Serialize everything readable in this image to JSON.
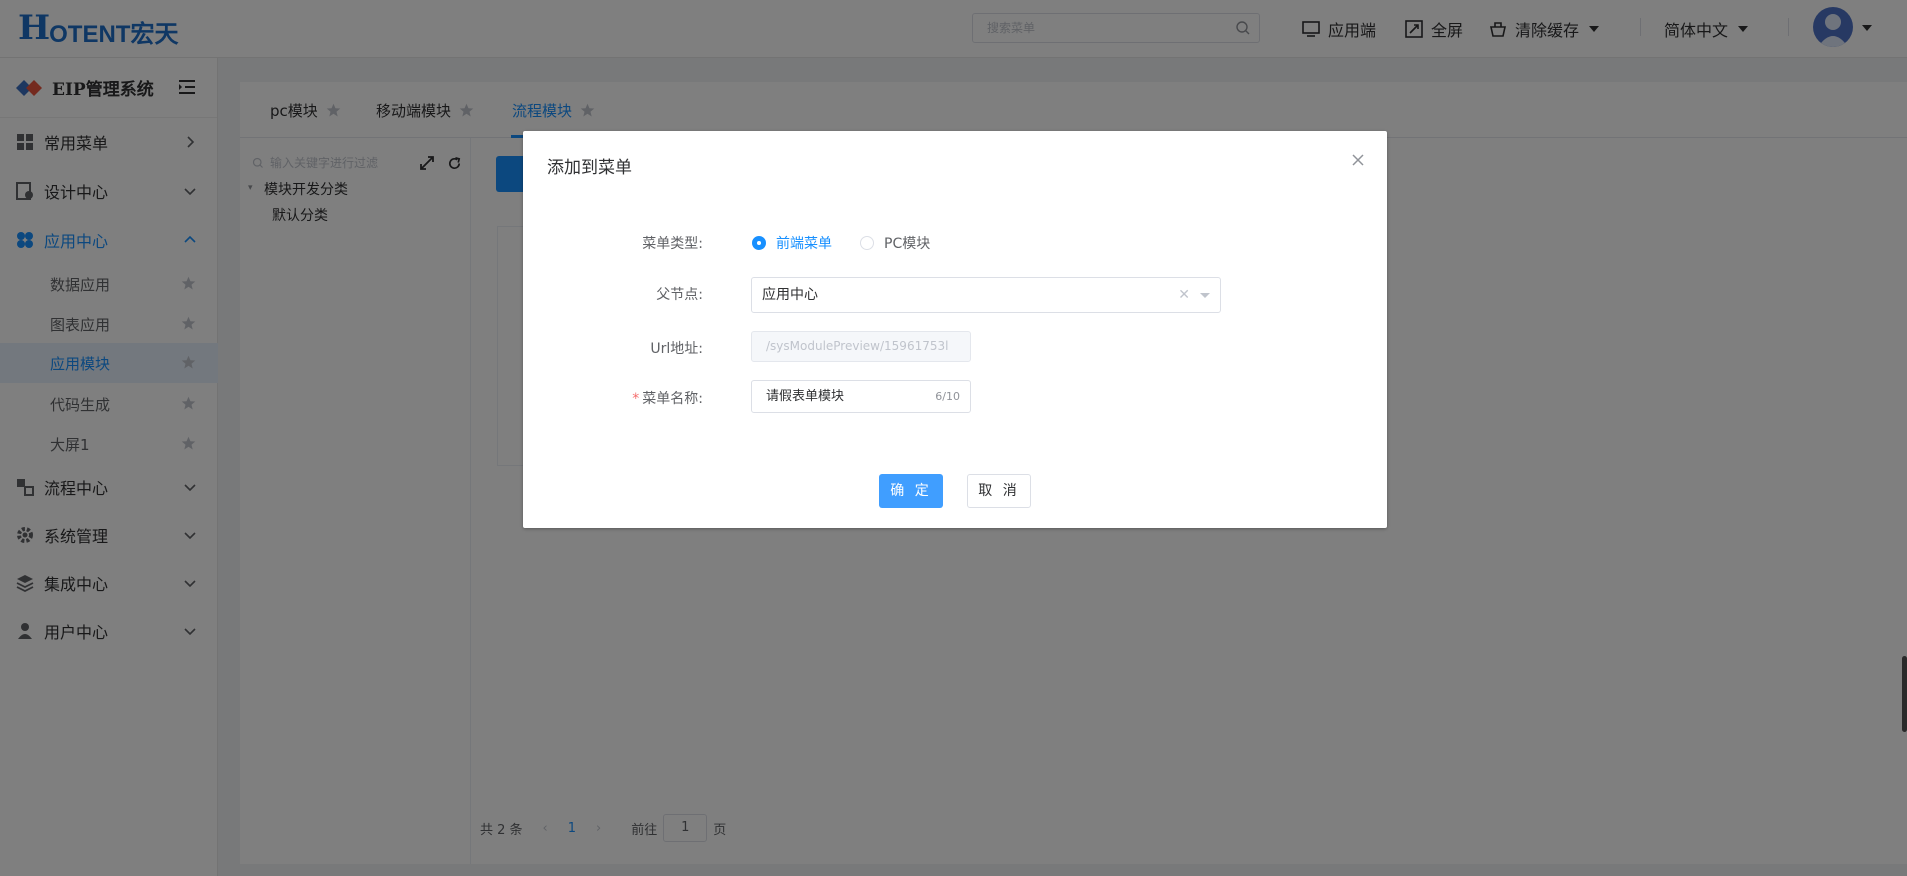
{
  "header": {
    "logo_text": "HOTENT宏天",
    "search_placeholder": "搜索菜单",
    "app_label": "应用端",
    "fullscreen_label": "全屏",
    "clear_cache_label": "清除缓存",
    "language_label": "简体中文"
  },
  "sidebar": {
    "brand": "EIP管理系统",
    "menus": [
      {
        "label": "常用菜单",
        "icon": "grid-icon"
      },
      {
        "label": "设计中心",
        "icon": "design-icon"
      },
      {
        "label": "应用中心",
        "icon": "apps-icon"
      },
      {
        "label": "流程中心",
        "icon": "flow-icon"
      },
      {
        "label": "系统管理",
        "icon": "gear-icon"
      },
      {
        "label": "集成中心",
        "icon": "layers-icon"
      },
      {
        "label": "用户中心",
        "icon": "user-icon"
      }
    ],
    "sub_items": [
      {
        "label": "数据应用"
      },
      {
        "label": "图表应用"
      },
      {
        "label": "应用模块"
      },
      {
        "label": "代码生成"
      },
      {
        "label": "大屏1"
      }
    ]
  },
  "tabs": [
    {
      "label": "pc模块"
    },
    {
      "label": "移动端模块"
    },
    {
      "label": "流程模块"
    }
  ],
  "tree": {
    "filter_placeholder": "输入关键字进行过滤",
    "root": "模块开发分类",
    "child": "默认分类"
  },
  "pager": {
    "total": "共 2 条",
    "current_page": "1",
    "goto_label": "前往",
    "goto_value": "1",
    "page_unit": "页"
  },
  "dialog": {
    "title": "添加到菜单",
    "menu_type_label": "菜单类型:",
    "radio_front": "前端菜单",
    "radio_pc": "PC模块",
    "parent_label": "父节点:",
    "parent_value": "应用中心",
    "url_label": "Url地址:",
    "url_value": "/sysModulePreview/15961753l",
    "name_label": "菜单名称:",
    "name_value": "请假表单模块",
    "name_count": "6/10",
    "confirm": "确 定",
    "cancel": "取 消"
  },
  "colors": {
    "primary": "#1890ff",
    "overlay": "rgba(0,0,0,0.5)"
  }
}
